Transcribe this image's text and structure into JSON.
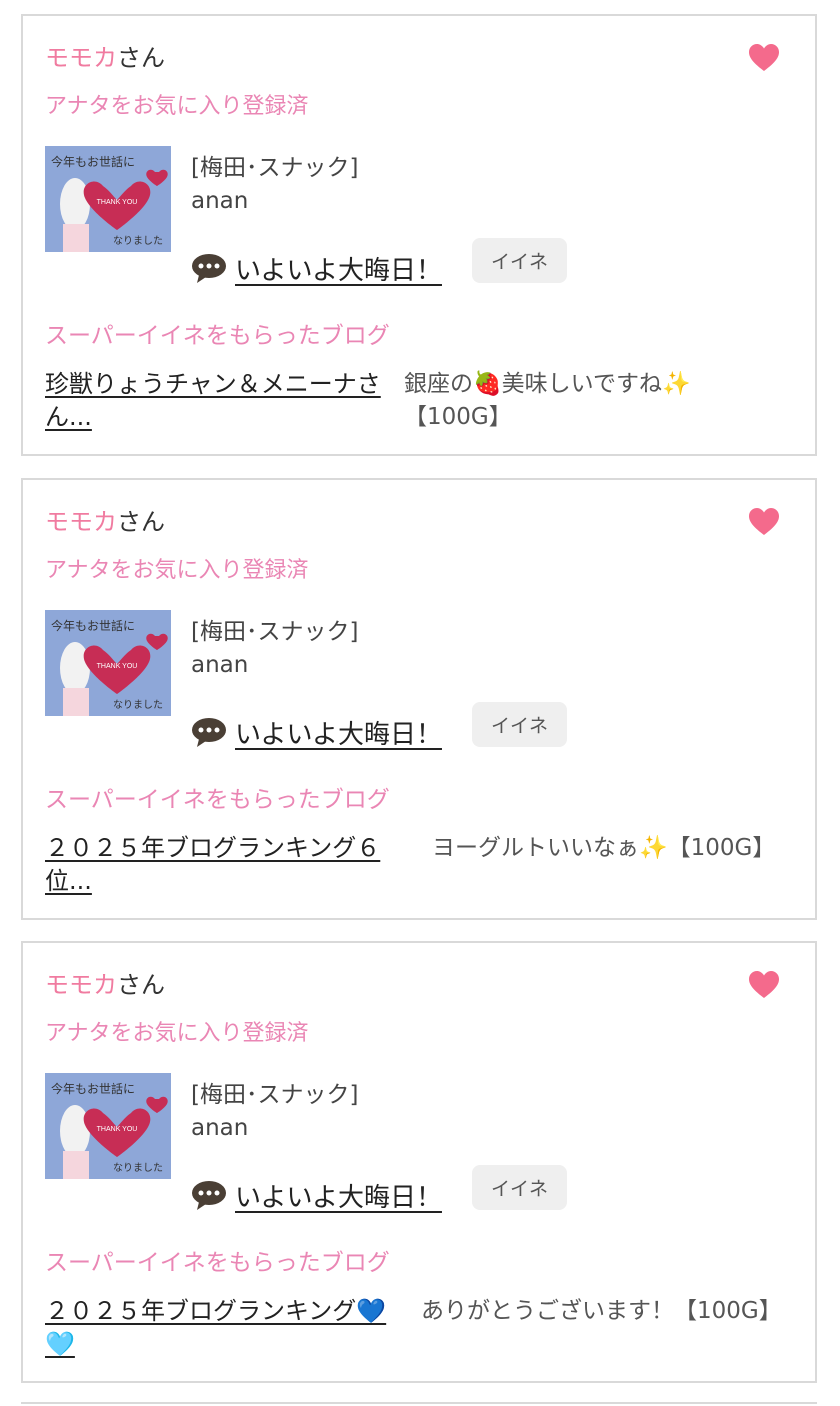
{
  "colors": {
    "accent_pink": "#f07ba0",
    "label_pink": "#ea86b4",
    "border": "#d9d9d9",
    "heart": "#f46a8c"
  },
  "cards": [
    {
      "name": "モモカ",
      "name_suffix": "さん",
      "favorite_label": "アナタをお気に入り登録済",
      "category": "[梅田･スナック]",
      "shop": "anan",
      "blog_title": "いよいよ大晦日！",
      "iine_label": "イイネ",
      "super_label": "スーパーイイネをもらったブログ",
      "entry_title": "珍獣りょうチャン＆メニーナさん...",
      "entry_comment": "銀座の🍓美味しいですね✨【100G】"
    },
    {
      "name": "モモカ",
      "name_suffix": "さん",
      "favorite_label": "アナタをお気に入り登録済",
      "category": "[梅田･スナック]",
      "shop": "anan",
      "blog_title": "いよいよ大晦日！",
      "iine_label": "イイネ",
      "super_label": "スーパーイイネをもらったブログ",
      "entry_title": "２０２５年ブログランキング６位...",
      "entry_comment": "ヨーグルトいいなぁ✨【100G】"
    },
    {
      "name": "モモカ",
      "name_suffix": "さん",
      "favorite_label": "アナタをお気に入り登録済",
      "category": "[梅田･スナック]",
      "shop": "anan",
      "blog_title": "いよいよ大晦日！",
      "iine_label": "イイネ",
      "super_label": "スーパーイイネをもらったブログ",
      "entry_title": "２０２５年ブログランキング💙🩵",
      "entry_comment": "ありがとうございます！【100G】"
    }
  ],
  "thumbnail_text": {
    "top": "今年もお世話に",
    "heart": "THANK YOU",
    "bottom": "なりました"
  }
}
